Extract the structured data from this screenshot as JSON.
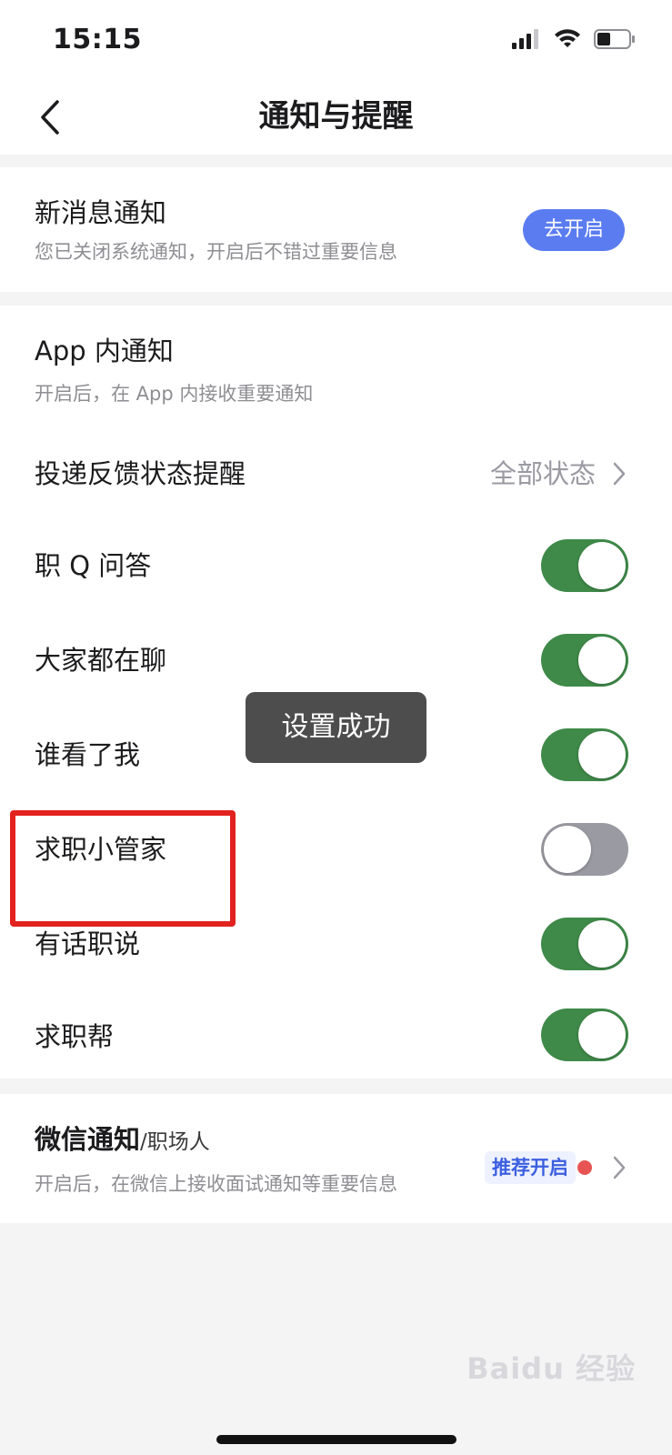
{
  "status_bar": {
    "time": "15:15"
  },
  "nav": {
    "title": "通知与提醒"
  },
  "new_message": {
    "title": "新消息通知",
    "subtitle": "您已关闭系统通知，开启后不错过重要信息",
    "button": "去开启"
  },
  "in_app": {
    "title": "App 内通知",
    "subtitle": "开启后，在 App 内接收重要通知"
  },
  "delivery_feedback": {
    "label": "投递反馈状态提醒",
    "value": "全部状态"
  },
  "toggles": [
    {
      "label": "职 Q 问答",
      "on": true
    },
    {
      "label": "大家都在聊",
      "on": true
    },
    {
      "label": "谁看了我",
      "on": true
    },
    {
      "label": "求职小管家",
      "on": false
    },
    {
      "label": "有话职说",
      "on": true
    },
    {
      "label": "求职帮",
      "on": true
    }
  ],
  "toast": "设置成功",
  "wechat": {
    "title": "微信通知",
    "suffix": "/职场人",
    "subtitle": "开启后，在微信上接收面试通知等重要信息",
    "tag": "推荐开启"
  },
  "watermark": "Baidu 经验",
  "colors": {
    "toggle_on": "#3f8a49",
    "toggle_off": "#9a9aa2",
    "primary_button": "#5b7cf0",
    "highlight": "#e2221f"
  }
}
